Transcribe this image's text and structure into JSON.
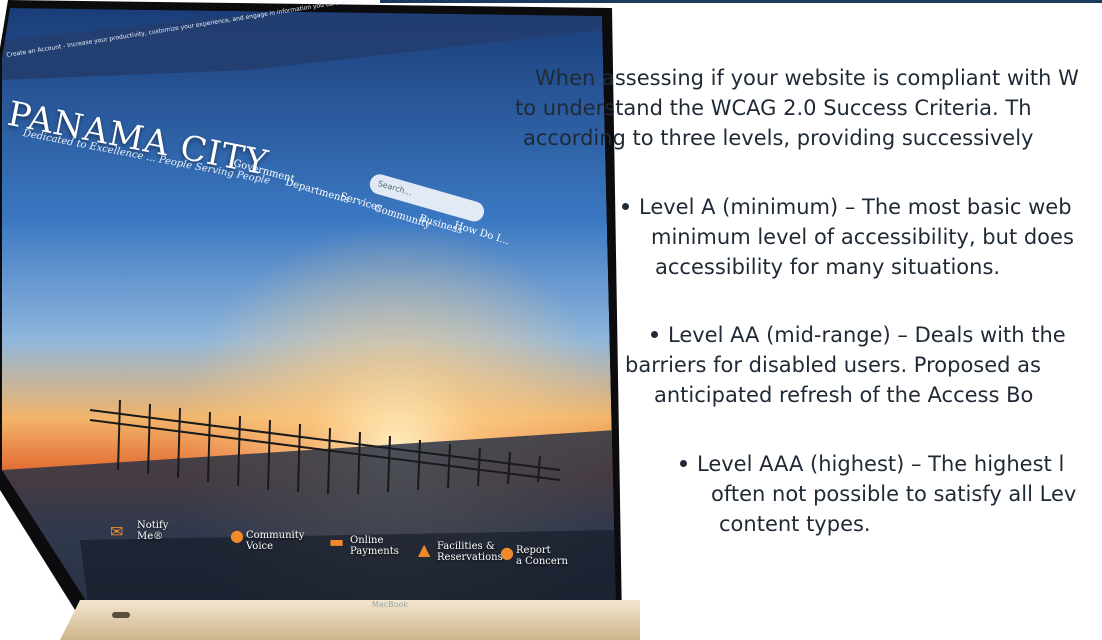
{
  "article": {
    "intro_lines": [
      "When assessing if your website is compliant with W",
      "to understand the WCAG 2.0 Success Criteria. Th",
      "according to three levels, providing successively"
    ],
    "bullets": [
      {
        "lines": [
          "Level A (minimum) – The most basic web",
          "minimum level of accessibility, but does",
          "accessibility for many situations."
        ]
      },
      {
        "lines": [
          "Level AA (mid-range) – Deals with the",
          "barriers for disabled users. Proposed as",
          "anticipated refresh of the Access Bo"
        ]
      },
      {
        "lines": [
          "Level AAA (highest) – The highest l",
          "often not possible to satisfy all Lev",
          "content types."
        ]
      }
    ]
  },
  "screen": {
    "banner": "Create an Account - Increase your productivity, customize your experience, and engage in information you care about.",
    "logo_title": "PANAMA CITY",
    "logo_tagline": "Dedicated to Excellence ... People Serving People",
    "nav": [
      "Government",
      "Departments",
      "Services",
      "Community",
      "Business",
      "How Do I..."
    ],
    "search_placeholder": "Search...",
    "quick_links": [
      {
        "label_1": "Notify",
        "label_2": "Me®",
        "icon": "envelope-icon"
      },
      {
        "label_1": "Community",
        "label_2": "Voice",
        "icon": "microphone-icon"
      },
      {
        "label_1": "Online",
        "label_2": "Payments",
        "icon": "card-icon"
      },
      {
        "label_1": "Facilities &",
        "label_2": "Reservations",
        "icon": "building-icon"
      },
      {
        "label_1": "Report",
        "label_2": "a Concern",
        "icon": "alert-icon"
      }
    ],
    "device_label": "MacBook"
  },
  "colors": {
    "accent": "#1b3a5c",
    "sky_top": "#1d4f8e",
    "sunset": "#f0842c",
    "laptop_gold": "#e9d8bd"
  }
}
